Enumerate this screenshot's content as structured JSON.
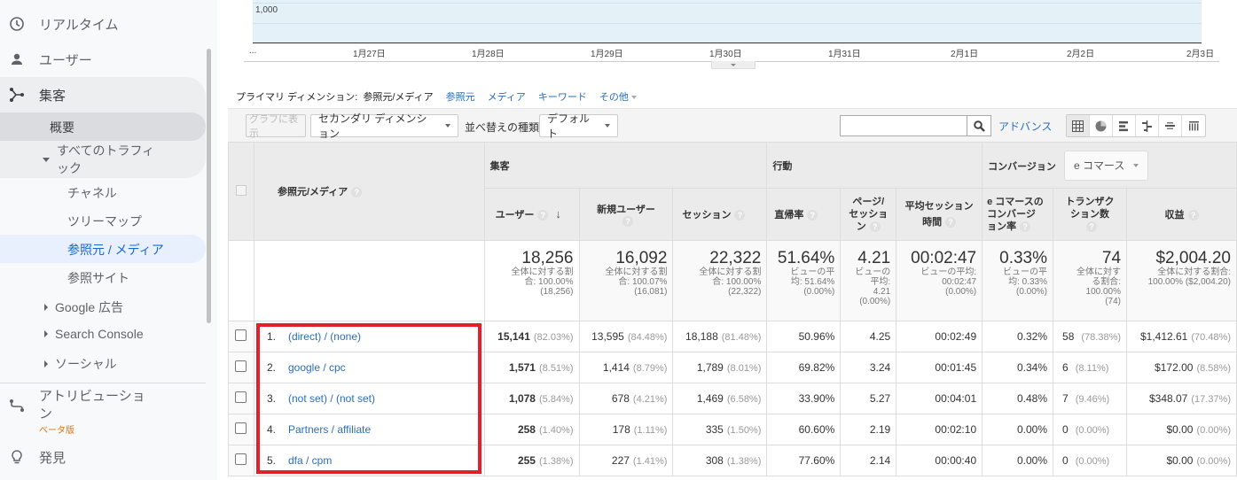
{
  "sidebar": {
    "items": [
      {
        "label": "リアルタイム",
        "icon": "clock-icon"
      },
      {
        "label": "ユーザー",
        "icon": "person-icon"
      },
      {
        "label": "集客",
        "icon": "acquisition-icon"
      }
    ],
    "acquisition_sub": {
      "overview": "概要",
      "all_traffic": "すべてのトラフィ\nック",
      "channels": "チャネル",
      "treemap": "ツリーマップ",
      "source_medium": "参照元 / メディア",
      "referrals": "参照サイト",
      "google_ads": "Google 広告",
      "search_console": "Search Console",
      "social": "ソーシャル"
    },
    "attribution": {
      "label": "アトリビューショ\nン",
      "badge": "ベータ版",
      "icon": "attribution-icon"
    },
    "discover": {
      "label": "発見",
      "icon": "lightbulb-icon"
    }
  },
  "chart": {
    "y_label": "1,000",
    "x_ticks": [
      "...",
      "1月27日",
      "1月28日",
      "1月29日",
      "1月30日",
      "1月31日",
      "2月1日",
      "2月2日",
      "2月3日"
    ]
  },
  "primary_dimension": {
    "label": "プライマリ ディメンション:",
    "current": "参照元/メディア",
    "options": [
      "参照元",
      "メディア",
      "キーワード",
      "その他"
    ]
  },
  "toolbar": {
    "plot_rows": "グラフに表示",
    "secondary_dimension": "セカンダリ ディメンション",
    "sort_label": "並べ替えの種類:",
    "sort_value": "デフォルト",
    "search_value": "",
    "advanced": "アドバンス"
  },
  "table": {
    "dimension_header": "参照元/メディア",
    "groups": {
      "acquisition": "集客",
      "behavior": "行動",
      "conversion": "コンバージョン",
      "conversion_select": "e コマース"
    },
    "columns": [
      "ユーザー",
      "新規ユーザー",
      "セッション",
      "直帰率",
      "ページ/\nセッショ\nン",
      "平均セッション\n時間",
      "e コマースの\nコンバージ\nョン率",
      "トランザク\nション数",
      "収益"
    ],
    "totals": [
      {
        "value": "18,256",
        "sub": "全体に対する割\n合: 100.00%\n(18,256)"
      },
      {
        "value": "16,092",
        "sub": "全体に対する割\n合: 100.07%\n(16,081)"
      },
      {
        "value": "22,322",
        "sub": "全体に対する割\n合: 100.00%\n(22,322)"
      },
      {
        "value": "51.64%",
        "sub": "ビューの平\n均: 51.64%\n(0.00%)"
      },
      {
        "value": "4.21",
        "sub": "ビューの\n平均:\n4.21\n(0.00%)"
      },
      {
        "value": "00:02:47",
        "sub": "ビューの平均:\n00:02:47\n(0.00%)"
      },
      {
        "value": "0.33%",
        "sub": "ビューの平\n均: 0.33%\n(0.00%)"
      },
      {
        "value": "74",
        "sub": "全体に対す\nる割合:\n100.00%\n(74)"
      },
      {
        "value": "$2,004.20",
        "sub": "全体に対する割合:\n100.00% ($2,004.20)"
      }
    ],
    "rows": [
      {
        "index": "1.",
        "dimension": "(direct) / (none)",
        "users": "15,141",
        "users_pct": "(82.03%)",
        "new_users": "13,595",
        "new_users_pct": "(84.48%)",
        "sessions": "18,188",
        "sessions_pct": "(81.48%)",
        "bounce": "50.96%",
        "pages": "4.25",
        "duration": "00:02:49",
        "conv": "0.32%",
        "trans": "58",
        "trans_pct": "(78.38%)",
        "revenue": "$1,412.61",
        "revenue_pct": "(70.48%)"
      },
      {
        "index": "2.",
        "dimension": "google / cpc",
        "users": "1,571",
        "users_pct": "(8.51%)",
        "new_users": "1,414",
        "new_users_pct": "(8.79%)",
        "sessions": "1,789",
        "sessions_pct": "(8.01%)",
        "bounce": "69.82%",
        "pages": "3.24",
        "duration": "00:01:45",
        "conv": "0.34%",
        "trans": "6",
        "trans_pct": "(8.11%)",
        "revenue": "$172.00",
        "revenue_pct": "(8.58%)"
      },
      {
        "index": "3.",
        "dimension": "(not set) / (not set)",
        "users": "1,078",
        "users_pct": "(5.84%)",
        "new_users": "678",
        "new_users_pct": "(4.21%)",
        "sessions": "1,469",
        "sessions_pct": "(6.58%)",
        "bounce": "33.90%",
        "pages": "5.27",
        "duration": "00:04:01",
        "conv": "0.48%",
        "trans": "7",
        "trans_pct": "(9.46%)",
        "revenue": "$348.07",
        "revenue_pct": "(17.37%)"
      },
      {
        "index": "4.",
        "dimension": "Partners / affiliate",
        "users": "258",
        "users_pct": "(1.40%)",
        "new_users": "178",
        "new_users_pct": "(1.11%)",
        "sessions": "335",
        "sessions_pct": "(1.50%)",
        "bounce": "60.60%",
        "pages": "2.19",
        "duration": "00:02:10",
        "conv": "0.00%",
        "trans": "0",
        "trans_pct": "(0.00%)",
        "revenue": "$0.00",
        "revenue_pct": "(0.00%)"
      },
      {
        "index": "5.",
        "dimension": "dfa / cpm",
        "users": "255",
        "users_pct": "(1.38%)",
        "new_users": "227",
        "new_users_pct": "(1.41%)",
        "sessions": "308",
        "sessions_pct": "(1.38%)",
        "bounce": "77.60%",
        "pages": "2.14",
        "duration": "00:00:40",
        "conv": "0.00%",
        "trans": "0",
        "trans_pct": "(0.00%)",
        "revenue": "$0.00",
        "revenue_pct": "(0.00%)"
      }
    ]
  },
  "colors": {
    "link": "#2a6ebb",
    "highlight": "#e0202a",
    "beta": "#e8710a",
    "chart_fill": "#e4f1f8"
  }
}
